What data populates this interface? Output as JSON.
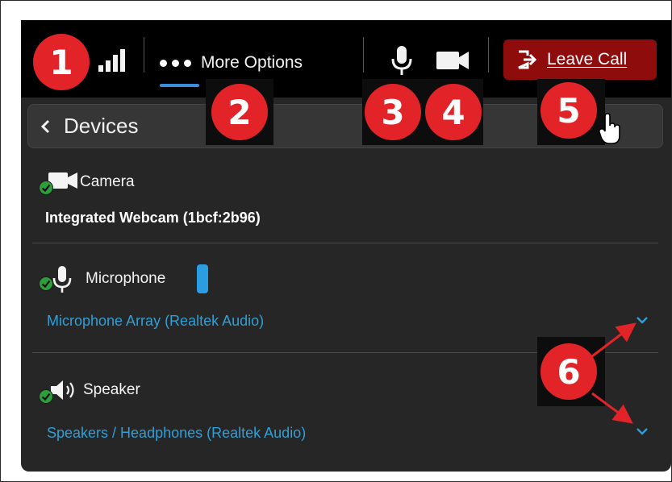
{
  "toolbar": {
    "more_options_label": "More Options",
    "leave_call_label": "Leave Call"
  },
  "devices": {
    "title": "Devices",
    "camera": {
      "label": "Camera",
      "value": "Integrated Webcam (1bcf:2b96)"
    },
    "microphone": {
      "label": "Microphone",
      "value": "Microphone Array (Realtek Audio)"
    },
    "speaker": {
      "label": "Speaker",
      "value": "Speakers / Headphones (Realtek Audio)"
    }
  },
  "callouts": [
    "1",
    "2",
    "3",
    "4",
    "5",
    "6"
  ],
  "colors": {
    "toolbar_bg": "#000000",
    "panel_bg": "#262626",
    "accent_blue": "#3b8ed8",
    "link_blue": "#2f9fd6",
    "leave_red": "#8e0c0c",
    "status_green": "#2e9e3a",
    "callout_red": "#e22428"
  },
  "icons": [
    "signal-icon",
    "more-dots-icon",
    "microphone-icon",
    "camera-icon",
    "leave-icon",
    "chevron-left-icon",
    "chevron-down-icon",
    "check-icon",
    "speaker-icon",
    "mic-level-icon",
    "hand-cursor-icon"
  ]
}
